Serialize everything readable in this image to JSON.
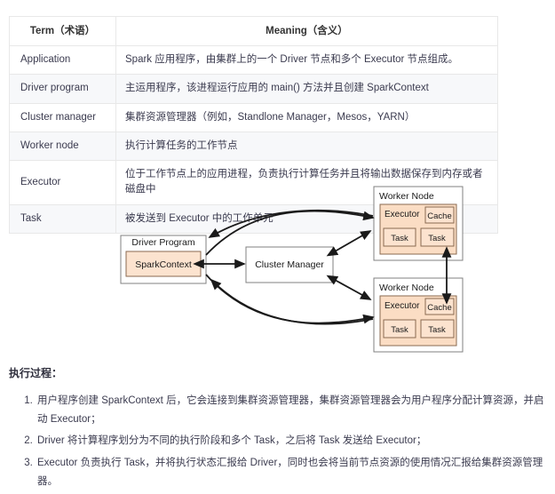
{
  "table": {
    "headers": [
      "Term（术语）",
      "Meaning（含义）"
    ],
    "rows": [
      {
        "term": "Application",
        "meaning": "Spark 应用程序，由集群上的一个 Driver 节点和多个 Executor 节点组成。"
      },
      {
        "term": "Driver program",
        "meaning": "主运用程序，该进程运行应用的 main() 方法并且创建 SparkContext"
      },
      {
        "term": "Cluster manager",
        "meaning": "集群资源管理器（例如，Standlone Manager，Mesos，YARN）"
      },
      {
        "term": "Worker node",
        "meaning": "执行计算任务的工作节点"
      },
      {
        "term": "Executor",
        "meaning": "位于工作节点上的应用进程，负责执行计算任务并且将输出数据保存到内存或者磁盘中"
      },
      {
        "term": "Task",
        "meaning": "被发送到 Executor 中的工作单元"
      }
    ]
  },
  "diagram": {
    "driver_program": "Driver Program",
    "spark_context": "SparkContext",
    "cluster_manager": "Cluster Manager",
    "worker_node_1": {
      "title": "Worker Node",
      "executor": "Executor",
      "cache": "Cache",
      "task_1": "Task",
      "task_2": "Task"
    },
    "worker_node_2": {
      "title": "Worker Node",
      "executor": "Executor",
      "cache": "Cache",
      "task_1": "Task",
      "task_2": "Task"
    },
    "colors": {
      "executor_fill": "#fbddc4",
      "inner_fill": "#fce3cf",
      "spark_context_fill": "#fce3cf",
      "box_stroke": "#808080",
      "arrow_stroke": "#1a1a1a"
    }
  },
  "process": {
    "title": "执行过程：",
    "steps": [
      "用户程序创建 SparkContext 后，它会连接到集群资源管理器，集群资源管理器会为用户程序分配计算资源，并启动 Executor；",
      "Driver 将计算程序划分为不同的执行阶段和多个 Task，之后将 Task 发送给 Executor；",
      "Executor 负责执行 Task，并将执行状态汇报给 Driver，同时也会将当前节点资源的使用情况汇报给集群资源管理器。"
    ]
  }
}
